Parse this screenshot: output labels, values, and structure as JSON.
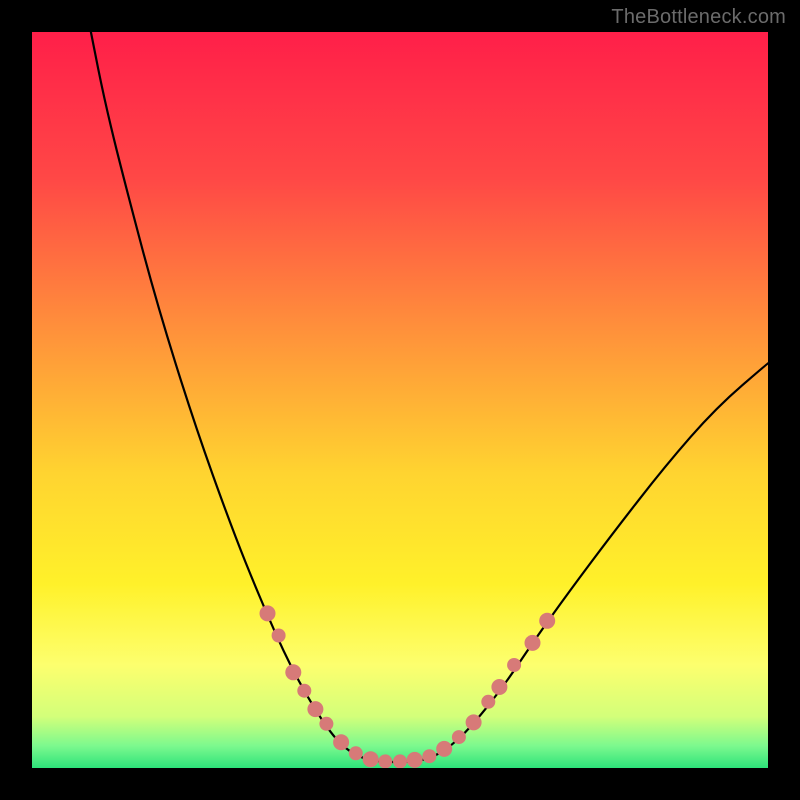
{
  "watermark": "TheBottleneck.com",
  "chart_data": {
    "type": "line",
    "title": "",
    "xlabel": "",
    "ylabel": "",
    "xlim": [
      0,
      100
    ],
    "ylim": [
      0,
      100
    ],
    "background_gradient": {
      "stops": [
        {
          "offset": 0.0,
          "color": "#ff1f49"
        },
        {
          "offset": 0.2,
          "color": "#ff4846"
        },
        {
          "offset": 0.4,
          "color": "#ff8f3b"
        },
        {
          "offset": 0.6,
          "color": "#ffd430"
        },
        {
          "offset": 0.75,
          "color": "#fff12a"
        },
        {
          "offset": 0.86,
          "color": "#fdff6e"
        },
        {
          "offset": 0.93,
          "color": "#d3ff7a"
        },
        {
          "offset": 0.97,
          "color": "#7cf98e"
        },
        {
          "offset": 1.0,
          "color": "#2de37a"
        }
      ]
    },
    "series": [
      {
        "name": "bottleneck-curve",
        "points": [
          {
            "x": 8.0,
            "y": 100.0
          },
          {
            "x": 10.0,
            "y": 90.0
          },
          {
            "x": 13.0,
            "y": 78.0
          },
          {
            "x": 17.0,
            "y": 63.0
          },
          {
            "x": 22.0,
            "y": 47.0
          },
          {
            "x": 27.0,
            "y": 33.0
          },
          {
            "x": 31.0,
            "y": 23.0
          },
          {
            "x": 35.0,
            "y": 14.0
          },
          {
            "x": 39.0,
            "y": 7.0
          },
          {
            "x": 42.0,
            "y": 3.0
          },
          {
            "x": 45.0,
            "y": 1.2
          },
          {
            "x": 48.0,
            "y": 0.8
          },
          {
            "x": 51.0,
            "y": 0.8
          },
          {
            "x": 54.0,
            "y": 1.2
          },
          {
            "x": 57.0,
            "y": 3.0
          },
          {
            "x": 60.0,
            "y": 6.0
          },
          {
            "x": 64.0,
            "y": 11.0
          },
          {
            "x": 68.0,
            "y": 17.0
          },
          {
            "x": 73.0,
            "y": 24.0
          },
          {
            "x": 79.0,
            "y": 32.0
          },
          {
            "x": 86.0,
            "y": 41.0
          },
          {
            "x": 93.0,
            "y": 49.0
          },
          {
            "x": 100.0,
            "y": 55.0
          }
        ]
      },
      {
        "name": "markers",
        "points": [
          {
            "x": 32.0,
            "y": 21.0,
            "r": 8
          },
          {
            "x": 33.5,
            "y": 18.0,
            "r": 7
          },
          {
            "x": 35.5,
            "y": 13.0,
            "r": 8
          },
          {
            "x": 37.0,
            "y": 10.5,
            "r": 7
          },
          {
            "x": 38.5,
            "y": 8.0,
            "r": 8
          },
          {
            "x": 40.0,
            "y": 6.0,
            "r": 7
          },
          {
            "x": 42.0,
            "y": 3.5,
            "r": 8
          },
          {
            "x": 44.0,
            "y": 2.0,
            "r": 7
          },
          {
            "x": 46.0,
            "y": 1.2,
            "r": 8
          },
          {
            "x": 48.0,
            "y": 0.9,
            "r": 7
          },
          {
            "x": 50.0,
            "y": 0.9,
            "r": 7
          },
          {
            "x": 52.0,
            "y": 1.1,
            "r": 8
          },
          {
            "x": 54.0,
            "y": 1.6,
            "r": 7
          },
          {
            "x": 56.0,
            "y": 2.6,
            "r": 8
          },
          {
            "x": 58.0,
            "y": 4.2,
            "r": 7
          },
          {
            "x": 60.0,
            "y": 6.2,
            "r": 8
          },
          {
            "x": 62.0,
            "y": 9.0,
            "r": 7
          },
          {
            "x": 63.5,
            "y": 11.0,
            "r": 8
          },
          {
            "x": 65.5,
            "y": 14.0,
            "r": 7
          },
          {
            "x": 68.0,
            "y": 17.0,
            "r": 8
          },
          {
            "x": 70.0,
            "y": 20.0,
            "r": 8
          }
        ]
      }
    ]
  }
}
